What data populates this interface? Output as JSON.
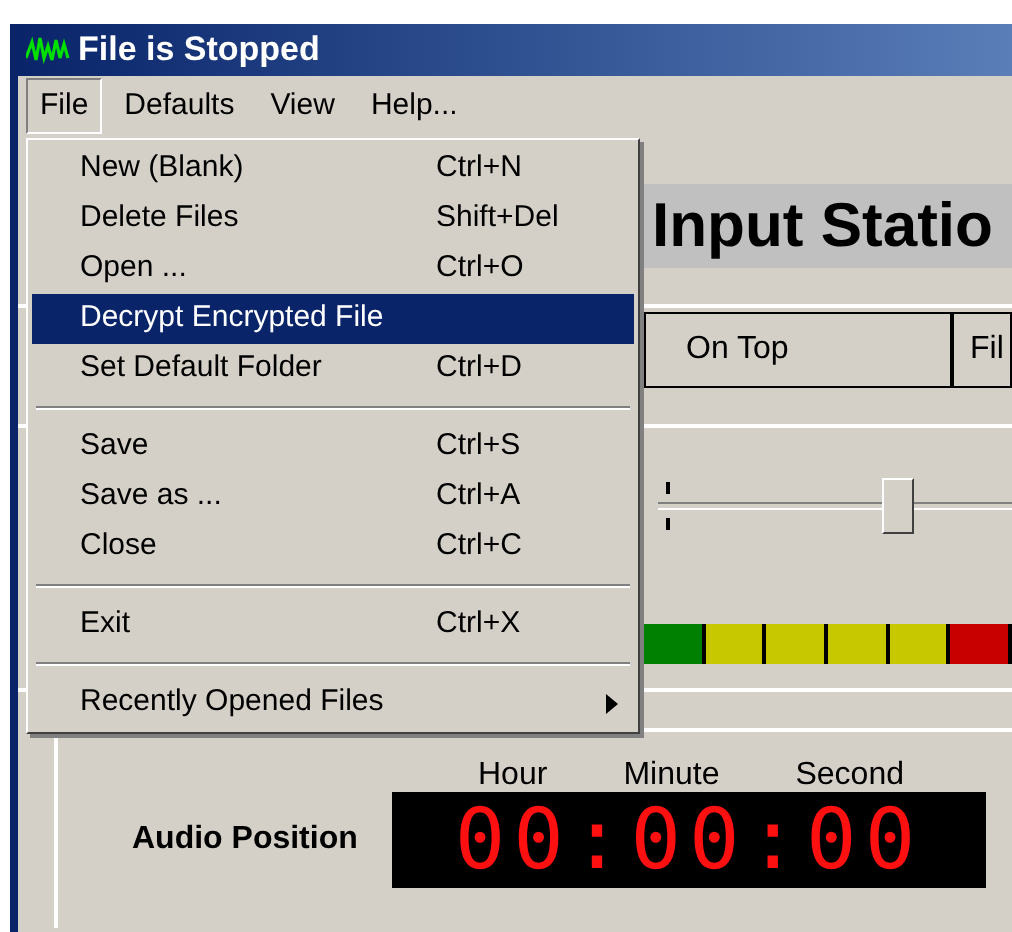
{
  "window": {
    "title": "File is Stopped"
  },
  "menu_bar": [
    {
      "label": "File",
      "selected": true
    },
    {
      "label": "Defaults",
      "selected": false
    },
    {
      "label": "View",
      "selected": false
    },
    {
      "label": "Help..."
    }
  ],
  "file_menu": [
    {
      "kind": "item",
      "label": "New (Blank)",
      "shortcut": "Ctrl+N",
      "selected": false
    },
    {
      "kind": "item",
      "label": "Delete Files",
      "shortcut": "Shift+Del",
      "selected": false
    },
    {
      "kind": "item",
      "label": "Open ...",
      "shortcut": "Ctrl+O",
      "selected": false
    },
    {
      "kind": "item",
      "label": "Decrypt Encrypted File",
      "selected": true
    },
    {
      "kind": "item",
      "label": "Set Default Folder",
      "shortcut": "Ctrl+D",
      "selected": false
    },
    {
      "kind": "separator"
    },
    {
      "kind": "item",
      "label": "Save",
      "shortcut": "Ctrl+S",
      "selected": false
    },
    {
      "kind": "item",
      "label": "Save as ...",
      "shortcut": "Ctrl+A",
      "selected": false
    },
    {
      "kind": "item",
      "label": "Close",
      "shortcut": "Ctrl+C",
      "selected": false
    },
    {
      "kind": "separator"
    },
    {
      "kind": "item",
      "label": "Exit",
      "shortcut": "Ctrl+X",
      "selected": false
    },
    {
      "kind": "separator"
    },
    {
      "kind": "submenu",
      "label": "Recently Opened Files",
      "selected": false
    }
  ],
  "header": {
    "title": "Input Statio"
  },
  "buttons": [
    "On Top",
    "Fil"
  ],
  "slider": {
    "level": 0.68
  },
  "meter": [
    {
      "color": "#008000"
    },
    {
      "color": "#c8c800"
    },
    {
      "color": "#c8c800"
    },
    {
      "color": "#c8c800"
    },
    {
      "color": "#c8c800"
    },
    {
      "color": "#c80000"
    }
  ],
  "position": {
    "label": "Audio Position",
    "units": [
      "Hour",
      "Minute",
      "Second"
    ],
    "display": "00:00:00"
  }
}
